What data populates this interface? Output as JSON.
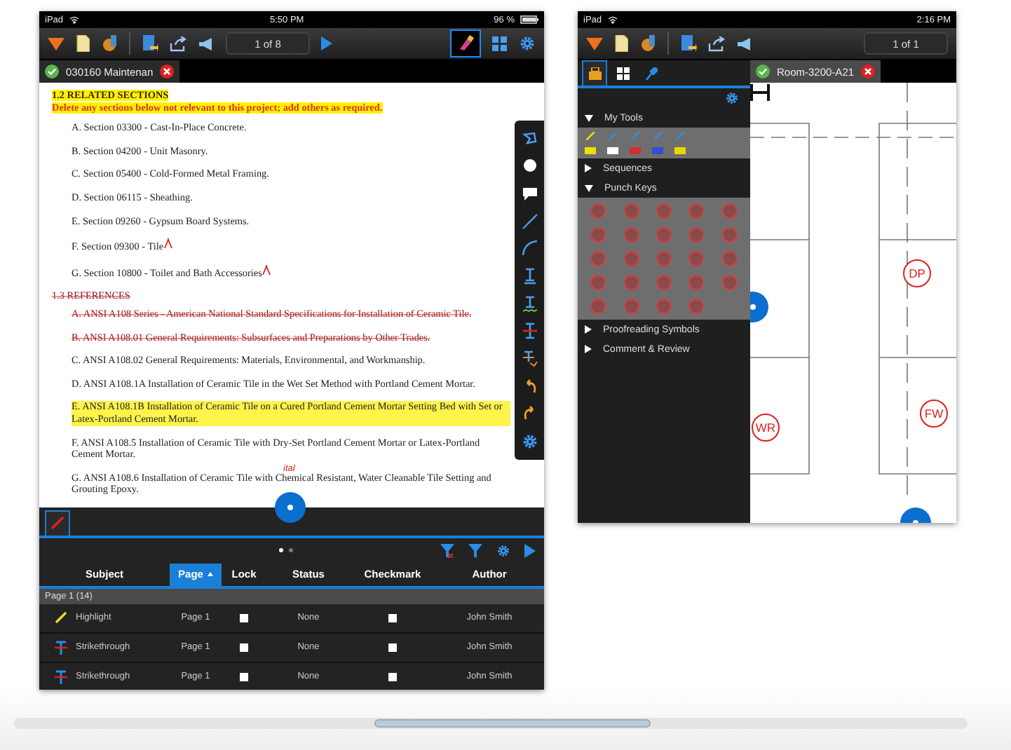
{
  "left_screen": {
    "status_bar": {
      "carrier": "iPad",
      "time": "5:50 PM",
      "battery": "96 %"
    },
    "toolbar": {
      "page_indicator": "1 of 8"
    },
    "document_tab": {
      "title": "030160 Maintenan"
    },
    "document": {
      "lines": [
        {
          "kind": "heading",
          "text": "1.2 RELATED SECTIONS"
        },
        {
          "kind": "note",
          "text": "Delete any sections below not relevant to this project; add others as required."
        },
        {
          "kind": "item",
          "text": "A. Section 03300 - Cast-In-Place Concrete."
        },
        {
          "kind": "item",
          "text": "B. Section 04200 - Unit Masonry."
        },
        {
          "kind": "item",
          "text": "C. Section 05400 - Cold-Formed Metal Framing."
        },
        {
          "kind": "item",
          "text": "D. Section 06115 - Sheathing."
        },
        {
          "kind": "item",
          "text": "E. Section 09260 - Gypsum Board Systems."
        },
        {
          "kind": "item",
          "text": "F. Section 09300 - Tile",
          "insert_mark": true
        },
        {
          "kind": "item",
          "text": "G. Section 10800 - Toilet and Bath Accessories",
          "insert_mark": true
        },
        {
          "kind": "struck_heading",
          "text": "1.3 REFERENCES"
        },
        {
          "kind": "struck",
          "text": "A. ANSI A108 Series - American National Standard Specifications for Installation of Ceramic Tile."
        },
        {
          "kind": "struck",
          "text": "B. ANSI A108.01 General Requirements: Subsurfaces and Preparations by Other Trades."
        },
        {
          "kind": "item",
          "text": "C. ANSI A108.02 General Requirements: Materials, Environmental, and Workmanship."
        },
        {
          "kind": "item",
          "text": "D. ANSI A108.1A Installation of Ceramic Tile in the Wet Set Method with Portland Cement Mortar."
        },
        {
          "kind": "highlighted",
          "text": "E. ANSI A108.1B Installation of Ceramic Tile on a Cured Portland Cement Mortar Setting Bed with Set or Latex-Portland Cement Mortar."
        },
        {
          "kind": "item",
          "text": "F. ANSI A108.5 Installation of Ceramic Tile with Dry-Set Portland Cement Mortar or Latex-Portland Cement Mortar."
        },
        {
          "kind": "item",
          "text": "G. ANSI A108.6 Installation of Ceramic Tile with Chemical Resistant, Water Cleanable Tile Setting and Grouting Epoxy.",
          "annotation": "ital"
        }
      ]
    },
    "markup_panel": {
      "tabs": [
        {
          "selected": true
        }
      ],
      "page_dots": [
        {
          "selected": true
        },
        {
          "selected": false
        }
      ],
      "columns": [
        {
          "label": "Subject",
          "selected": false
        },
        {
          "label": "Page",
          "selected": true
        },
        {
          "label": "Lock",
          "selected": false
        },
        {
          "label": "Status",
          "selected": false
        },
        {
          "label": "Checkmark",
          "selected": false
        },
        {
          "label": "Author",
          "selected": false
        }
      ],
      "group": "Page 1 (14)",
      "rows": [
        {
          "kind": "highlight",
          "subject": "Highlight",
          "page": "Page 1",
          "lock": false,
          "status": "None",
          "checkmark": false,
          "author": "John Smith"
        },
        {
          "kind": "strikethrough",
          "subject": "Strikethrough",
          "page": "Page 1",
          "lock": false,
          "status": "None",
          "checkmark": false,
          "author": "John Smith"
        },
        {
          "kind": "strikethrough",
          "subject": "Strikethrough",
          "page": "Page 1",
          "lock": false,
          "status": "None",
          "checkmark": false,
          "author": "John Smith"
        }
      ]
    }
  },
  "right_screen": {
    "status_bar": {
      "carrier": "iPad",
      "time": "2:16 PM"
    },
    "toolbar": {
      "page_indicator": "1 of 1"
    },
    "panel_tabs": [
      {
        "selected": true
      },
      {
        "selected": false
      },
      {
        "selected": false
      }
    ],
    "sections": [
      {
        "kind": "tools",
        "label": "My Tools",
        "expanded": true
      },
      {
        "label": "Sequences",
        "expanded": false
      },
      {
        "kind": "punch_keys",
        "label": "Punch Keys",
        "expanded": true
      },
      {
        "label": "Proofreading Symbols",
        "expanded": false
      },
      {
        "label": "Comment & Review",
        "expanded": false
      }
    ],
    "my_tools": [
      {
        "color": "#f0e000"
      },
      {
        "color": "#ffffff"
      },
      {
        "color": "#d03030"
      },
      {
        "color": "#3050d0"
      },
      {
        "color": "#e8d800"
      }
    ],
    "document_tab": {
      "title": "Room-3200-A21"
    },
    "plan_labels": [
      "DP",
      "WR",
      "FW"
    ]
  }
}
